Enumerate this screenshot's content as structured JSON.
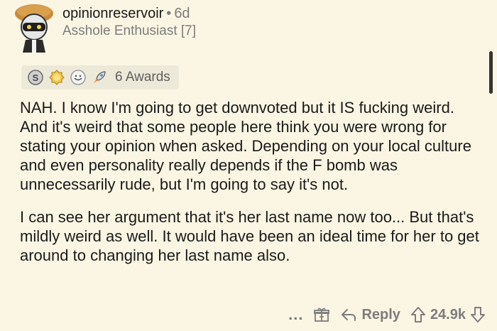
{
  "comment": {
    "author": "opinionreservoir",
    "separator": "•",
    "age": "6d",
    "flair": "Asshole Enthusiast [7]",
    "awards_label": "6 Awards",
    "paragraphs": [
      "NAH. I know I'm going to get downvoted but it IS fucking weird. And it's weird that some people here think you were wrong for stating your opinion when asked. Depending on your local culture and even personality really depends if the F bomb was unnecessarily rude, but I'm going to say it's not.",
      "I can see her argument that it's her last name now too... But that's mildly weird as well. It would have been an ideal time for her to get around to changing her last name also."
    ]
  },
  "actions": {
    "more": "...",
    "reply_label": "Reply",
    "score": "24.9k"
  },
  "colors": {
    "background": "#fbf6e3",
    "muted_text": "#7c7c7c",
    "body_text": "#1a1a1b",
    "award_bar": "#ede9d8"
  },
  "icons": {
    "avatar": "snoo-avatar",
    "awards": [
      "silver-award-icon",
      "gold-award-icon",
      "wholesome-award-icon",
      "rocket-award-icon"
    ],
    "gift": "gift-icon",
    "reply": "reply-arrow-icon",
    "upvote": "upvote-arrow-icon",
    "downvote": "downvote-arrow-icon"
  }
}
